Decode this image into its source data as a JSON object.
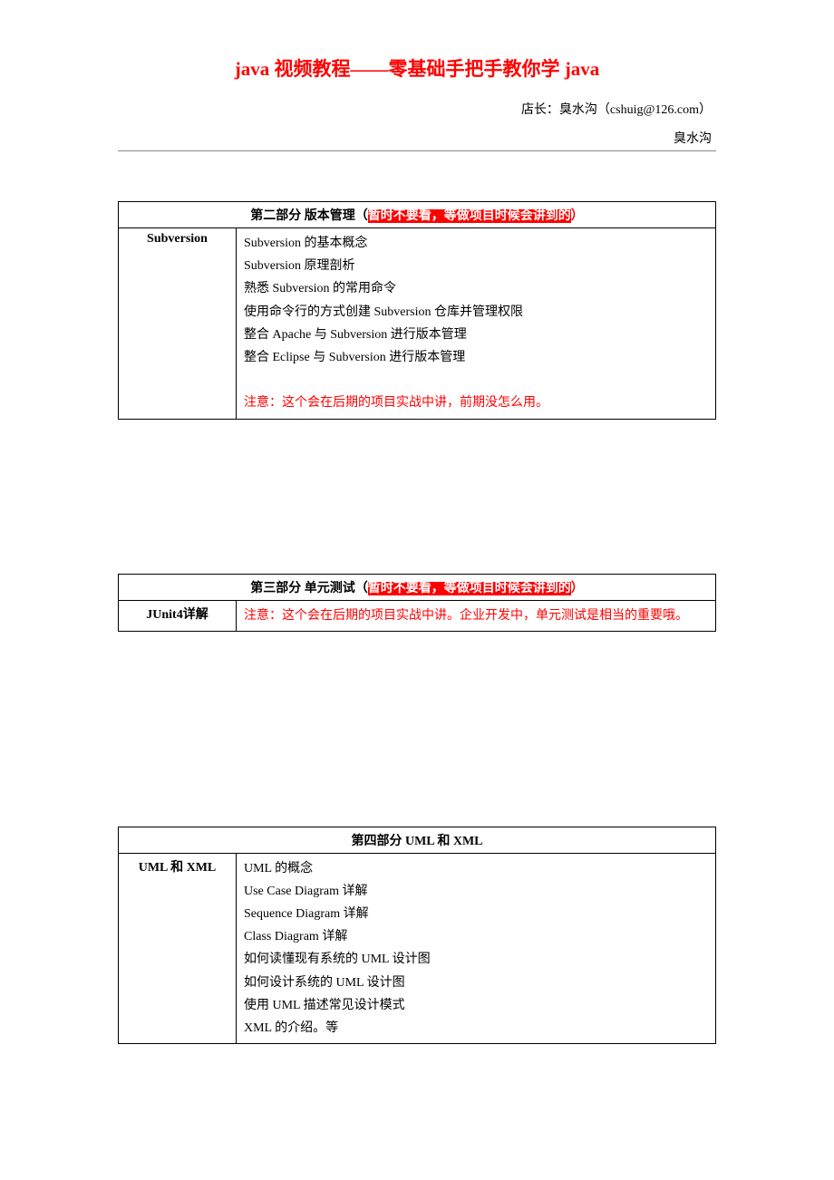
{
  "title": "java 视频教程——零基础手把手教你学 java",
  "author": "店长：臭水沟（cshuig@126.com）",
  "footer_label": "臭水沟",
  "section2": {
    "header_prefix": "第二部分  版本管理（",
    "header_highlight": "暂时不要看，等做项目时候会讲到的",
    "header_suffix": "）",
    "left_label": "Subversion",
    "items": [
      "Subversion 的基本概念",
      "Subversion 原理剖析",
      "熟悉 Subversion 的常用命令",
      "使用命令行的方式创建 Subversion 仓库并管理权限",
      "整合 Apache 与 Subversion 进行版本管理",
      "整合 Eclipse 与 Subversion 进行版本管理"
    ],
    "note": "注意：这个会在后期的项目实战中讲，前期没怎么用。"
  },
  "section3": {
    "header_prefix": "第三部分  单元测试（",
    "header_highlight": "暂时不要看，等做项目时候会讲到的",
    "header_suffix": "）",
    "left_label": "JUnit4详解",
    "note": "注意：这个会在后期的项目实战中讲。企业开发中，单元测试是相当的重要哦。"
  },
  "section4": {
    "header": "第四部分  UML 和 XML",
    "left_label": "UML 和 XML",
    "items": [
      "UML 的概念",
      "Use Case Diagram 详解",
      "Sequence Diagram 详解",
      "Class Diagram 详解",
      "如何读懂现有系统的 UML 设计图",
      "如何设计系统的 UML 设计图",
      "使用 UML 描述常见设计模式",
      "XML 的介绍。等"
    ]
  }
}
